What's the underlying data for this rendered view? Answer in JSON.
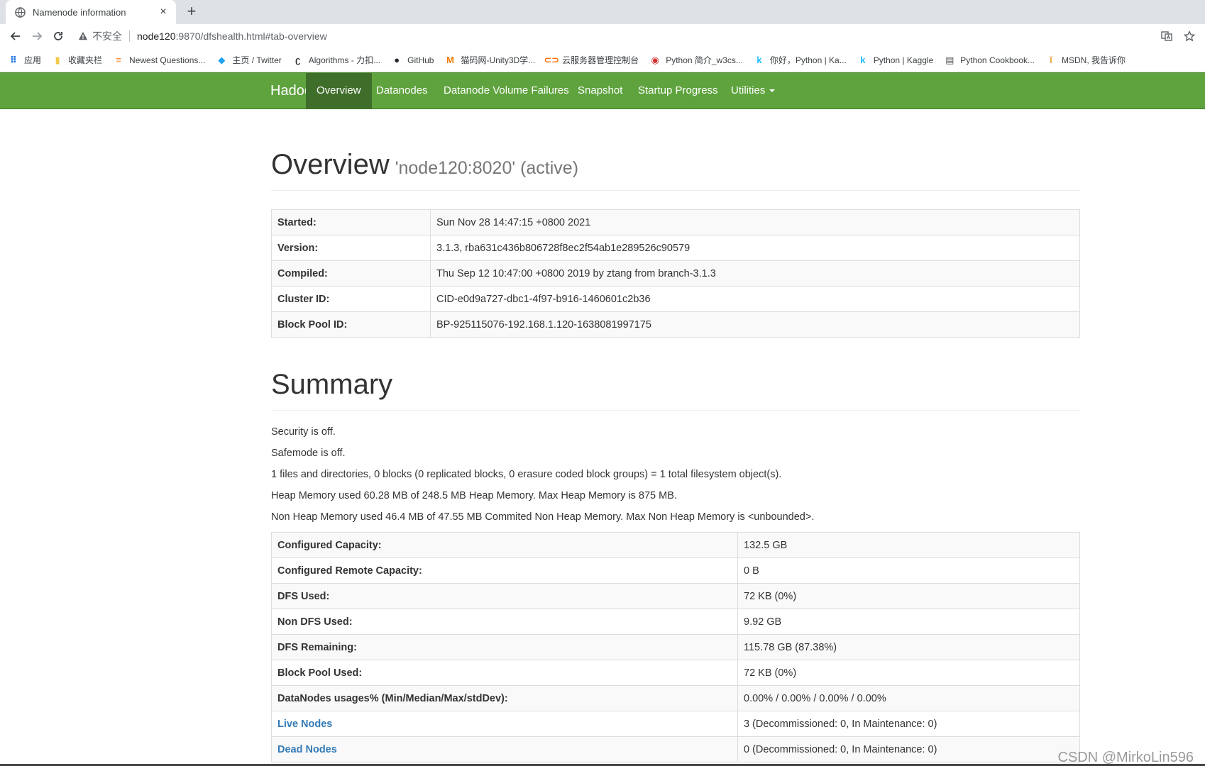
{
  "browser": {
    "tab_title": "Namenode information",
    "close_glyph": "×",
    "newtab_glyph": "+",
    "insecure_label": "不安全",
    "url_host": "node120",
    "url_path": ":9870/dfshealth.html#tab-overview",
    "bookmarks": [
      {
        "label": "应用",
        "icon": "apps-icon"
      },
      {
        "label": "收藏夹栏",
        "icon": "folder-icon"
      },
      {
        "label": "Newest Questions...",
        "icon": "stackoverflow-icon"
      },
      {
        "label": "主页 / Twitter",
        "icon": "twitter-icon"
      },
      {
        "label": "Algorithms - 力扣...",
        "icon": "leetcode-icon"
      },
      {
        "label": "GitHub",
        "icon": "github-icon"
      },
      {
        "label": "猫码网-Unity3D学...",
        "icon": "m-icon"
      },
      {
        "label": "云服务器管理控制台",
        "icon": "aliyun-icon"
      },
      {
        "label": "Python 简介_w3cs...",
        "icon": "w3c-icon"
      },
      {
        "label": "你好，Python | Ka...",
        "icon": "kaggle-icon"
      },
      {
        "label": "Python | Kaggle",
        "icon": "kaggle-icon"
      },
      {
        "label": "Python Cookbook...",
        "icon": "book-icon"
      },
      {
        "label": "MSDN, 我告诉你",
        "icon": "msdn-icon"
      }
    ]
  },
  "navbar": {
    "brand": "Hadoop",
    "items": [
      {
        "label": "Overview",
        "active": true
      },
      {
        "label": "Datanodes"
      },
      {
        "label": "Datanode Volume Failures"
      },
      {
        "label": "Snapshot"
      },
      {
        "label": "Startup Progress"
      },
      {
        "label": "Utilities"
      }
    ]
  },
  "overview": {
    "title": "Overview",
    "subtitle": "'node120:8020' (active)",
    "rows": [
      {
        "key": "Started:",
        "value": "Sun Nov 28 14:47:15 +0800 2021"
      },
      {
        "key": "Version:",
        "value": "3.1.3, rba631c436b806728f8ec2f54ab1e289526c90579"
      },
      {
        "key": "Compiled:",
        "value": "Thu Sep 12 10:47:00 +0800 2019 by ztang from branch-3.1.3"
      },
      {
        "key": "Cluster ID:",
        "value": "CID-e0d9a727-dbc1-4f97-b916-1460601c2b36"
      },
      {
        "key": "Block Pool ID:",
        "value": "BP-925115076-192.168.1.120-1638081997175"
      }
    ]
  },
  "summary": {
    "title": "Summary",
    "lines": [
      "Security is off.",
      "Safemode is off.",
      "1 files and directories, 0 blocks (0 replicated blocks, 0 erasure coded block groups) = 1 total filesystem object(s).",
      "Heap Memory used 60.28 MB of 248.5 MB Heap Memory. Max Heap Memory is 875 MB.",
      "Non Heap Memory used 46.4 MB of 47.55 MB Commited Non Heap Memory. Max Non Heap Memory is <unbounded>."
    ],
    "rows": [
      {
        "key": "Configured Capacity:",
        "value": "132.5 GB"
      },
      {
        "key": "Configured Remote Capacity:",
        "value": "0 B"
      },
      {
        "key": "DFS Used:",
        "value": "72 KB (0%)"
      },
      {
        "key": "Non DFS Used:",
        "value": "9.92 GB"
      },
      {
        "key": "DFS Remaining:",
        "value": "115.78 GB (87.38%)"
      },
      {
        "key": "Block Pool Used:",
        "value": "72 KB (0%)"
      },
      {
        "key": "DataNodes usages% (Min/Median/Max/stdDev):",
        "value": "0.00% / 0.00% / 0.00% / 0.00%"
      },
      {
        "key": "Live Nodes",
        "value": "3 (Decommissioned: 0, In Maintenance: 0)",
        "link": true
      },
      {
        "key": "Dead Nodes",
        "value": "0 (Decommissioned: 0, In Maintenance: 0)",
        "link": true
      }
    ]
  },
  "watermark": "CSDN @MirkoLin596"
}
